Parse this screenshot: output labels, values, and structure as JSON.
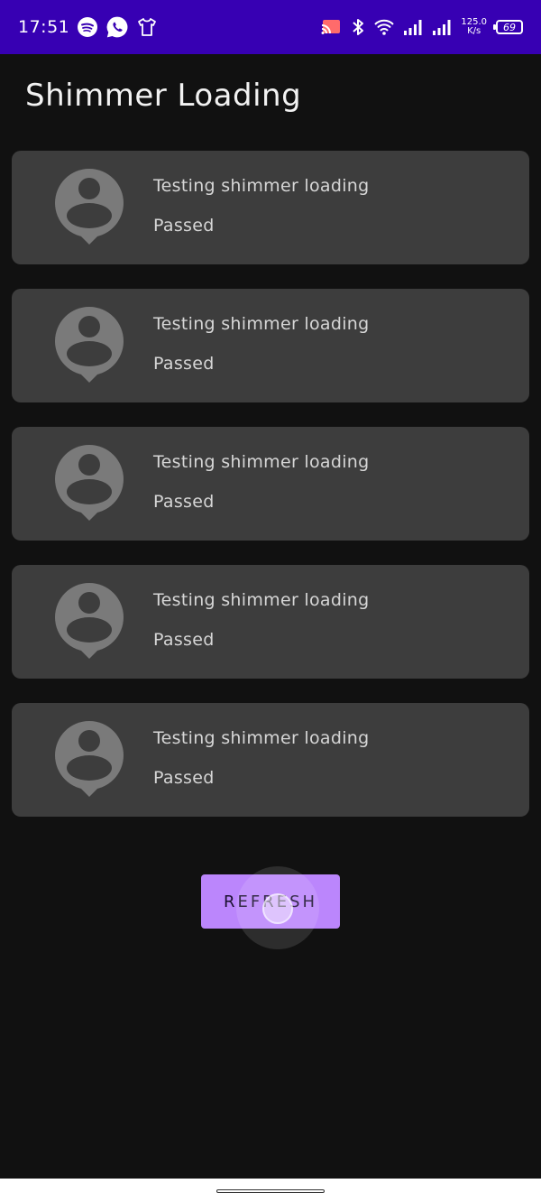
{
  "status_bar": {
    "time": "17:51",
    "left_icons": [
      "spotify-icon",
      "whatsapp-icon",
      "tshirt-icon"
    ],
    "right_icons": [
      "cast-icon",
      "bluetooth-icon",
      "wifi-icon",
      "signal-icon",
      "signal-icon"
    ],
    "speed_value": "125.0",
    "speed_unit": "K/s",
    "battery": "69",
    "background": "#3700b3"
  },
  "header": {
    "title": "Shimmer Loading"
  },
  "cards": [
    {
      "title": "Testing shimmer loading",
      "subtitle": "Passed"
    },
    {
      "title": "Testing shimmer loading",
      "subtitle": "Passed"
    },
    {
      "title": "Testing shimmer loading",
      "subtitle": "Passed"
    },
    {
      "title": "Testing shimmer loading",
      "subtitle": "Passed"
    },
    {
      "title": "Testing shimmer loading",
      "subtitle": "Passed"
    }
  ],
  "actions": {
    "refresh_label": "REFRESH",
    "accent": "#bb86fc"
  },
  "colors": {
    "background": "#111111",
    "card": "#3d3d3d",
    "avatar": "#7a7a7a"
  }
}
